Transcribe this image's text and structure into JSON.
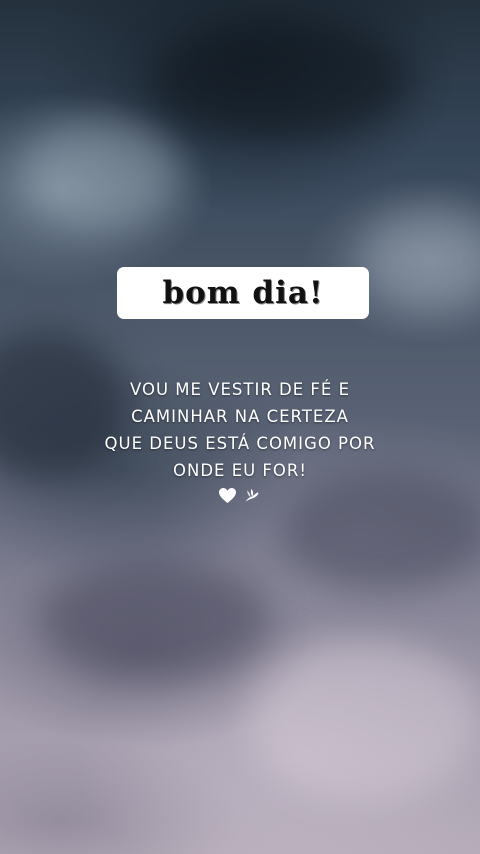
{
  "title": "bom dia!",
  "quote": {
    "lines": [
      "VOU ME VESTIR DE FÉ E",
      "CAMINHAR NA CERTEZA",
      "QUE DEUS ESTÁ COMIGO POR",
      "ONDE EU FOR!"
    ]
  },
  "icons": [
    "heart-icon",
    "dove-icon"
  ],
  "colors": {
    "title_box": "#ffffff",
    "title_text": "#111111",
    "quote_text": "#ffffff"
  }
}
